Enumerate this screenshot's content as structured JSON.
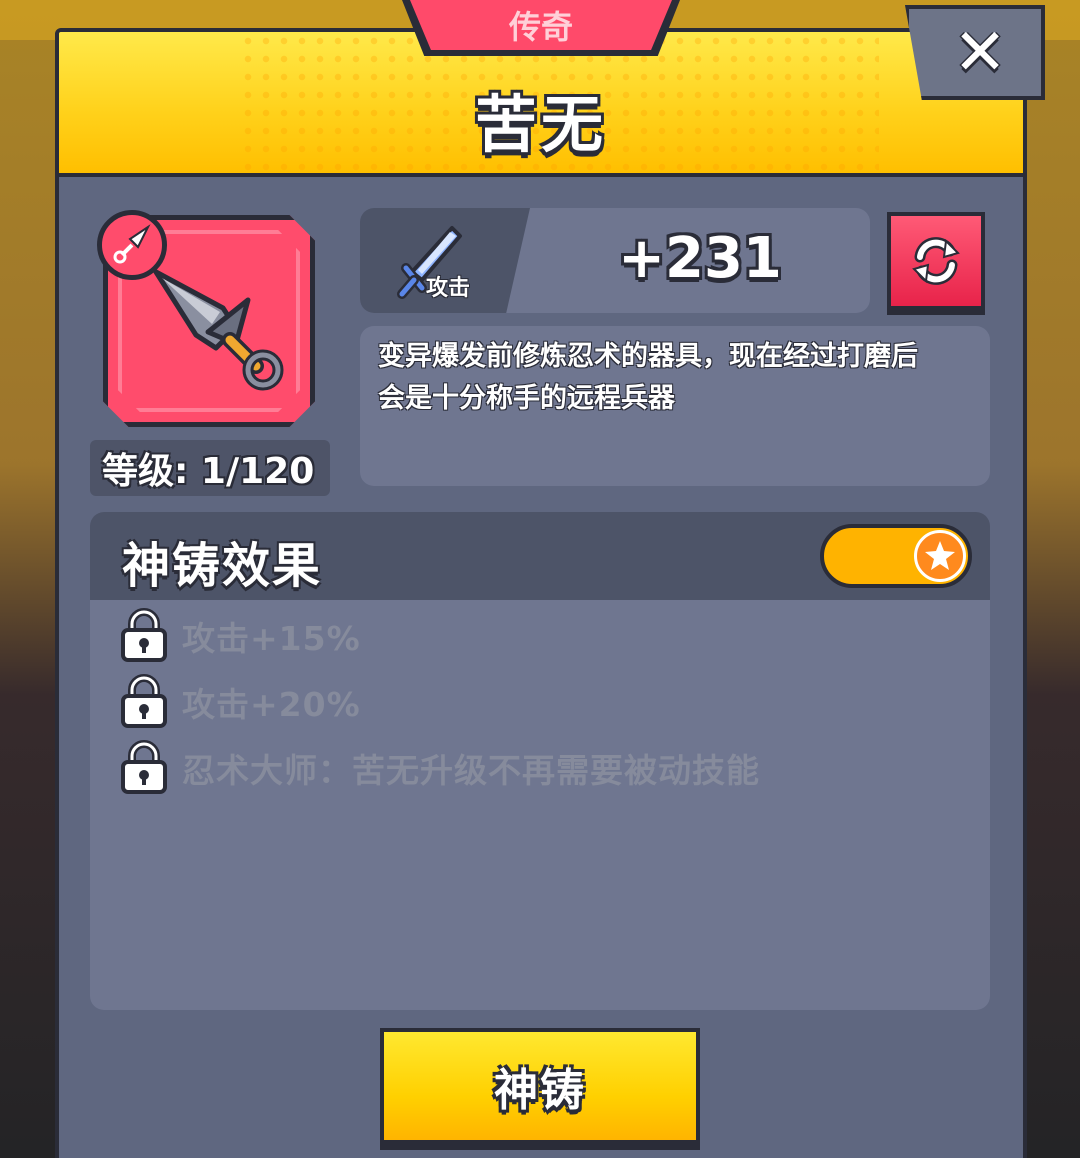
{
  "rarity_label": "传奇",
  "item_name": "苦无",
  "close_label": "✕",
  "level": {
    "text": "等级: 1/120"
  },
  "stat": {
    "label": "攻击",
    "value": "+231"
  },
  "description": {
    "line1": "变异爆发前修炼忍术的器具，现在经过打磨后",
    "line2": "会是十分称手的远程兵器"
  },
  "forge": {
    "title": "神铸效果",
    "toggle_on": true,
    "effects": [
      {
        "text": "攻击+15%",
        "locked": true
      },
      {
        "text": "攻击+20%",
        "locked": true
      },
      {
        "text": "忍术大师：苦无升级不再需要被动技能",
        "locked": true
      }
    ]
  },
  "forge_button_label": "神铸",
  "colors": {
    "header_yellow": "#ffd21c",
    "panel_bg": "#5f6780",
    "rarity_red": "#ff4a6a",
    "outline": "#2a2c38"
  }
}
